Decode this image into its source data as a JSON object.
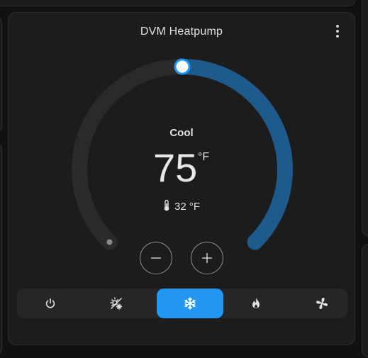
{
  "card": {
    "title": "DVM Heatpump"
  },
  "thermostat": {
    "mode_label": "Cool",
    "target_temp": "75",
    "target_unit": "°F",
    "current_temp": "32 °F",
    "target_fraction": 0.5
  },
  "colors": {
    "accent": "#1e5a8c",
    "track": "#2a2a2a",
    "active_mode": "#2196f3"
  },
  "modes": [
    {
      "name": "off",
      "icon": "power-icon",
      "active": false
    },
    {
      "name": "heat-cool",
      "icon": "sun-snowflake-icon",
      "active": false
    },
    {
      "name": "cool",
      "icon": "snowflake-icon",
      "active": true
    },
    {
      "name": "heat",
      "icon": "fire-icon",
      "active": false
    },
    {
      "name": "fan-only",
      "icon": "fan-icon",
      "active": false
    }
  ]
}
